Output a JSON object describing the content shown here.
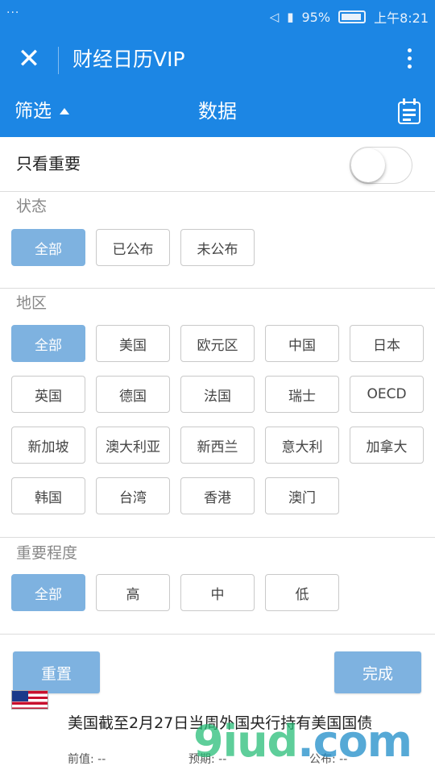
{
  "status_bar": {
    "dots": "···",
    "battery": "95%",
    "time": "上午8:21"
  },
  "app_bar": {
    "title": "财经日历VIP"
  },
  "filter_bar": {
    "filter_label": "筛选",
    "title": "数据"
  },
  "important_only": {
    "label": "只看重要",
    "enabled": false
  },
  "status_section": {
    "title": "状态",
    "options": [
      {
        "label": "全部",
        "selected": true
      },
      {
        "label": "已公布",
        "selected": false
      },
      {
        "label": "未公布",
        "selected": false
      }
    ]
  },
  "region_section": {
    "title": "地区",
    "options": [
      {
        "label": "全部",
        "selected": true
      },
      {
        "label": "美国",
        "selected": false
      },
      {
        "label": "欧元区",
        "selected": false
      },
      {
        "label": "中国",
        "selected": false
      },
      {
        "label": "日本",
        "selected": false
      },
      {
        "label": "英国",
        "selected": false
      },
      {
        "label": "德国",
        "selected": false
      },
      {
        "label": "法国",
        "selected": false
      },
      {
        "label": "瑞士",
        "selected": false
      },
      {
        "label": "OECD",
        "selected": false
      },
      {
        "label": "新加坡",
        "selected": false
      },
      {
        "label": "澳大利亚",
        "selected": false
      },
      {
        "label": "新西兰",
        "selected": false
      },
      {
        "label": "意大利",
        "selected": false
      },
      {
        "label": "加拿大",
        "selected": false
      },
      {
        "label": "韩国",
        "selected": false
      },
      {
        "label": "台湾",
        "selected": false
      },
      {
        "label": "香港",
        "selected": false
      },
      {
        "label": "澳门",
        "selected": false
      }
    ]
  },
  "importance_section": {
    "title": "重要程度",
    "options": [
      {
        "label": "全部",
        "selected": true
      },
      {
        "label": "高",
        "selected": false
      },
      {
        "label": "中",
        "selected": false
      },
      {
        "label": "低",
        "selected": false
      }
    ]
  },
  "actions": {
    "reset_label": "重置",
    "done_label": "完成"
  },
  "news_item": {
    "title": "美国截至2月27日当周外国央行持有美国国债",
    "prev_label": "前值: --",
    "forecast_label": "预期: --",
    "actual_label": "公布: --"
  },
  "watermark": {
    "text": "9iud",
    "suffix": ".com"
  },
  "colors": {
    "primary": "#1c86e4",
    "chip_selected": "#7eb2e0",
    "divider": "#dcdcdc"
  }
}
